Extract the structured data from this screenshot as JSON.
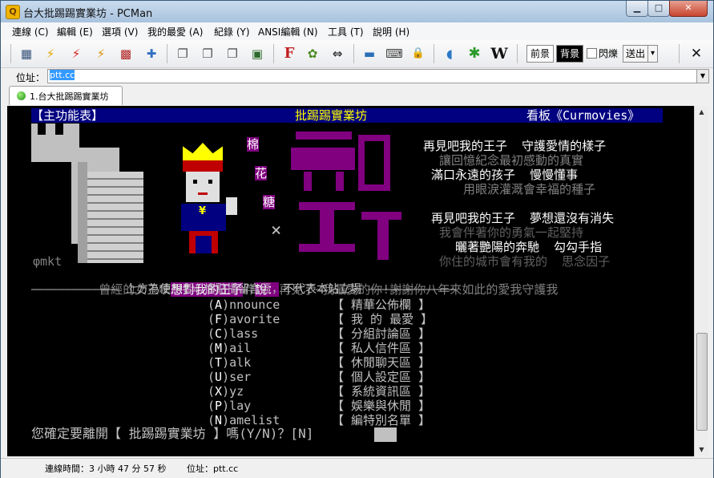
{
  "window": {
    "title": "台大批踢踢實業坊 - PCMan",
    "app_icon": "pcman-app-icon",
    "minimize_glyph": "▁",
    "maximize_glyph": "□",
    "close_glyph": "✕"
  },
  "menu": [
    "連線 (C)",
    "編輯 (E)",
    "選項 (V)",
    "我的最愛 (A)",
    "紀錄 (Y)",
    "ANSI編輯 (N)",
    "工具 (T)",
    "說明 (H)"
  ],
  "toolbar": {
    "icons": [
      "site-list-icon",
      "connect-icon",
      "disconnect-icon",
      "reconnect-icon",
      "close-connection-icon",
      "add-favorite-icon",
      "copy-icon",
      "paste-icon",
      "copy-with-ansi-icon",
      "preview-icon",
      "font-icon",
      "settings-gear-icon",
      "fullscreen-icon",
      "picture-icon",
      "keyboard-icon",
      "lock-icon",
      "pcman-icon",
      "emoticon-flower-icon",
      "wikipedia-icon"
    ],
    "glyphs": [
      "▦",
      "⚡",
      "⚡",
      "⚡",
      "▩",
      "✚",
      "❐",
      "❐",
      "❐",
      "▣",
      "F",
      "✿",
      "⇔",
      "▬",
      "⌨",
      "🔒",
      "◖",
      "✱",
      "W"
    ],
    "foreground_label": "前景",
    "background_label": "背景",
    "blink_label": "閃爍",
    "send_label": "送出",
    "send_arrow": "▾",
    "close_tab_glyph": "✕",
    "blink_checked": false
  },
  "address": {
    "label": "位址：",
    "value": "ptt.cc"
  },
  "tabs": [
    {
      "label": "1.台大批踢踢實業坊"
    }
  ],
  "terminal": {
    "header_left": "【主功能表】",
    "header_center": "批踢踢實業坊",
    "header_right": "看板《Curmovies》",
    "art_lines": [
      {
        "text": "棉",
        "color": "#ffffff",
        "bg": "#800080"
      },
      {
        "text": "花",
        "color": "#ffffff",
        "bg": "#800080"
      },
      {
        "text": "糖",
        "color": "#ffffff",
        "bg": "#800080"
      }
    ],
    "lyrics": [
      {
        "text": "再見吧我的王子  守護愛情的樣子",
        "color": "#ffffff"
      },
      {
        "text": "讓回憶紀念最初感動的真實",
        "color": "#808080"
      },
      {
        "text": "滿口永遠的孩子  慢慢懂事",
        "color": "#ffffff"
      },
      {
        "text": "用眼淚灌溉會幸福的種子",
        "color": "#808080"
      },
      {
        "text": "再見吧我的王子  夢想還沒有消失",
        "color": "#ffffff"
      },
      {
        "text": "我會伴著你的勇氣一起堅持",
        "color": "#606060"
      },
      {
        "text": "曬著艷陽的奔馳  勾勾手指",
        "color": "#ffffff"
      },
      {
        "text": "你住的城市會有我的  思念因子",
        "color": "#606060"
      }
    ],
    "art_x": "×",
    "signature": "φmkt",
    "marquee": [
      {
        "text": "曾經的女王噗",
        "color": "#808080",
        "bg": "#000000"
      },
      {
        "text": "想對我的王子",
        "color": "#ffffff",
        "bg": "#800080"
      },
      {
        "text": "胖",
        "color": "#808080",
        "bg": "#000000"
      },
      {
        "text": "說：",
        "color": "#ffffff",
        "bg": "#800080"
      },
      {
        "text": "再見了~我最愛的你!謝謝你八年來如此的愛我守護我",
        "color": "#808080",
        "bg": "#000000"
      }
    ],
    "divider": "————————————— 上方為使用者心情點播留言區，不代表本站立場 —————————————",
    "menu_items": [
      {
        "key": "A",
        "word": "nnounce",
        "desc": "精華公佈欄"
      },
      {
        "key": "F",
        "word": "avorite",
        "desc": "我 的 最愛"
      },
      {
        "key": "C",
        "word": "lass",
        "desc": "分組討論區"
      },
      {
        "key": "M",
        "word": "ail",
        "desc": "私人信件區"
      },
      {
        "key": "T",
        "word": "alk",
        "desc": "休閒聊天區"
      },
      {
        "key": "U",
        "word": "ser",
        "desc": "個人設定區"
      },
      {
        "key": "X",
        "word": "yz",
        "desc": "系統資訊區"
      },
      {
        "key": "P",
        "word": "lay",
        "desc": "娛樂與休閒"
      },
      {
        "key": "N",
        "word": "amelist",
        "desc": "編特別名單"
      }
    ],
    "prompt": "您確定要離開【 批踢踢實業坊 】嗎(Y/N)？[N]"
  },
  "scrollbar": {
    "up": "▲",
    "down": "▼"
  },
  "status": {
    "connected_time": "連線時間：3 小時 47 分 57 秒",
    "address": "位址：ptt.cc"
  },
  "colors": {
    "header_bar": "#000080",
    "menu_key": "#ffffff",
    "menu_text": "#c0c0c0",
    "art_purple": "#800080",
    "art_gray": "#c0c0c0"
  }
}
